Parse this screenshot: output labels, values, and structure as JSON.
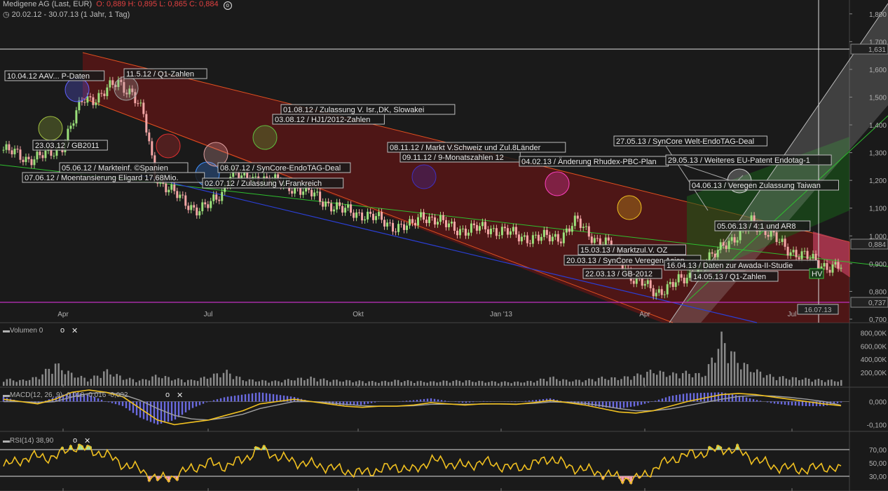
{
  "header": {
    "title": "Medigene AG (Last, EUR)",
    "ohlc": "O: 0,889  H: 0,895  L: 0,865  C: 0,884",
    "range": "20.02.12 - 30.07.13 (1 Jahr, 1 Tag)"
  },
  "colors": {
    "background": "#1a1a1a",
    "up_candle": "#9be07a",
    "down_candle": "#f4a6a6",
    "channel_fill": "#7a1414",
    "green_line": "#2fbf2f",
    "blue_line": "#2b3fd6",
    "magenta_line": "#c030c0",
    "macd_line": "#f0c020",
    "signal_line": "#a0a0a0",
    "histogram": "#6a6ae0",
    "rsi_line": "#f0c020"
  },
  "chart_data": [
    {
      "type": "line",
      "title": "Medigene AG (Last, EUR)",
      "xlabel": "",
      "ylabel": "",
      "x_ticks": [
        "Apr",
        "Jul",
        "Okt",
        "Jan '13",
        "Apr",
        "Jul"
      ],
      "y_ticks": [
        "1,800",
        "1,700",
        "1,600",
        "1,500",
        "1,400",
        "1,300",
        "1,200",
        "1,100",
        "1,000",
        "0,900",
        "0,800",
        "0,700"
      ],
      "ylim": [
        0.7,
        1.85
      ],
      "grid": false,
      "last_price_label": "0,884",
      "hline_labels": [
        "1,631",
        "0,737"
      ],
      "cursor_date_label": "16.07.13",
      "marker_label": "HV",
      "series": [
        {
          "x": [
            "2012-02-20",
            "2012-03-05",
            "2012-03-20",
            "2012-03-28",
            "2012-04-10",
            "2012-04-18",
            "2012-05-02",
            "2012-05-11",
            "2012-05-18",
            "2012-05-25",
            "2012-06-05",
            "2012-06-12",
            "2012-06-20",
            "2012-06-29",
            "2012-07-06",
            "2012-07-12",
            "2012-07-20",
            "2012-08-01",
            "2012-08-10",
            "2012-08-24",
            "2012-09-07",
            "2012-09-20",
            "2012-10-03",
            "2012-10-20",
            "2012-11-02",
            "2012-11-09",
            "2012-11-23",
            "2012-12-07",
            "2012-12-21",
            "2013-01-08",
            "2013-01-22",
            "2013-02-04",
            "2013-02-14",
            "2013-02-28",
            "2013-03-08",
            "2013-03-15",
            "2013-03-22",
            "2013-04-05",
            "2013-04-15",
            "2013-04-29",
            "2013-05-10",
            "2013-05-17",
            "2013-05-27",
            "2013-06-04",
            "2013-06-12",
            "2013-06-20",
            "2013-06-28",
            "2013-07-09",
            "2013-07-16",
            "2013-07-30"
          ],
          "values": [
            1.31,
            1.28,
            1.29,
            1.33,
            1.49,
            1.5,
            1.55,
            1.52,
            1.43,
            1.22,
            1.16,
            1.12,
            1.1,
            1.11,
            1.15,
            1.24,
            1.2,
            1.21,
            1.19,
            1.17,
            1.13,
            1.09,
            1.08,
            1.04,
            1.03,
            1.08,
            1.04,
            1.02,
            1.03,
            1.0,
            0.99,
            1.0,
            1.05,
            0.98,
            0.96,
            0.9,
            0.84,
            0.8,
            0.82,
            0.87,
            0.92,
            0.98,
            0.99,
            1.06,
            1.02,
            0.98,
            0.95,
            0.92,
            0.9,
            0.884
          ]
        }
      ],
      "annotations": [
        "10.04.12 AAV... P-Daten",
        "11.5.12 / Q1-Zahlen",
        "23.03.12 / GB2011",
        "05.06.12 / Markteinf. ©Spanien",
        "07.06.12 / Moentansierung Eligard 17,68Mio.",
        "08.07.12 / SynCore-EndoTAG-Deal",
        "02.07.12 / Zulassung V.Frankreich",
        "01.08.12 / Zulassung V. Isr.,DK, Slowakei",
        "03.08.12 / HJ1/2012-Zahlen",
        "08.11.12 / Markt V.Schweiz und Zul.8Länder",
        "09.11.12 / 9-Monatszahlen 12",
        "04.02.13 / Änderung Rhudex-PBC-Plan",
        "27.05.13 / SynCore Welt-EndoTAG-Deal",
        "29.05.13 / Weiteres EU-Patent Endotag-1",
        "04.06.13 / Veregen Zulassung Taiwan",
        "05.06.13 / 4:1 und AR8",
        "15.03.13 / Marktzul.V. OZ",
        "20.03.13 / SynCore Veregen Asien",
        "16.04.13 / Daten zur Awada-II-Studie",
        "22.03.13 / GB-2012",
        "14.05.13 / Q1-Zahlen"
      ]
    },
    {
      "type": "bar",
      "title": "Volumen",
      "value_label": "0",
      "y_ticks": [
        "800,00K",
        "600,00K",
        "400,00K",
        "200,00K"
      ],
      "ylim": [
        0,
        900000
      ],
      "values": [
        120000,
        90000,
        150000,
        380000,
        200000,
        110000,
        260000,
        140000,
        90000,
        180000,
        120000,
        95000,
        160000,
        250000,
        110000,
        90000,
        80000,
        120000,
        140000,
        100000,
        90000,
        80000,
        70000,
        95000,
        80000,
        70000,
        85000,
        90000,
        75000,
        70000,
        65000,
        80000,
        150000,
        90000,
        100000,
        140000,
        130000,
        180000,
        260000,
        200000,
        230000,
        180000,
        820000,
        420000,
        260000,
        160000,
        140000,
        120000,
        100000,
        90000
      ]
    },
    {
      "type": "line",
      "title": "MACD(12, 26, 9)",
      "values_label": "-0,018  -0,016  -0,002",
      "y_ticks": [
        "0,000",
        "-0,100"
      ],
      "ylim": [
        -0.12,
        0.05
      ],
      "series": [
        {
          "name": "MACD",
          "values": [
            0.01,
            0.0,
            -0.01,
            0.01,
            0.04,
            0.05,
            0.04,
            0.02,
            -0.03,
            -0.08,
            -0.1,
            -0.09,
            -0.08,
            -0.06,
            -0.04,
            -0.01,
            0.0,
            0.01,
            0.0,
            -0.01,
            -0.02,
            -0.025,
            -0.02,
            -0.02,
            -0.015,
            -0.005,
            -0.01,
            -0.015,
            -0.01,
            -0.01,
            -0.012,
            -0.005,
            0.005,
            -0.005,
            -0.015,
            -0.03,
            -0.045,
            -0.05,
            -0.04,
            -0.02,
            0.0,
            0.015,
            0.03,
            0.035,
            0.03,
            0.02,
            0.01,
            0.0,
            -0.01,
            -0.018
          ]
        },
        {
          "name": "Signal",
          "values": [
            0.0,
            0.0,
            -0.005,
            0.0,
            0.02,
            0.035,
            0.04,
            0.03,
            0.005,
            -0.03,
            -0.06,
            -0.075,
            -0.08,
            -0.07,
            -0.055,
            -0.03,
            -0.015,
            0.0,
            0.0,
            -0.005,
            -0.012,
            -0.018,
            -0.02,
            -0.02,
            -0.018,
            -0.012,
            -0.011,
            -0.012,
            -0.011,
            -0.01,
            -0.011,
            -0.008,
            -0.002,
            -0.003,
            -0.008,
            -0.018,
            -0.03,
            -0.04,
            -0.04,
            -0.032,
            -0.018,
            -0.004,
            0.01,
            0.022,
            0.026,
            0.024,
            0.018,
            0.01,
            0.0,
            -0.016
          ]
        }
      ]
    },
    {
      "type": "line",
      "title": "RSI(14)",
      "value_label": "38,90",
      "y_ticks": [
        "70,00",
        "50,00",
        "30,00"
      ],
      "ylim": [
        10,
        90
      ],
      "series": [
        {
          "name": "RSI",
          "values": [
            45,
            55,
            60,
            58,
            75,
            70,
            62,
            48,
            40,
            25,
            30,
            42,
            50,
            45,
            55,
            72,
            60,
            52,
            48,
            44,
            38,
            35,
            40,
            45,
            38,
            55,
            50,
            45,
            52,
            46,
            42,
            48,
            58,
            45,
            40,
            35,
            28,
            25,
            40,
            55,
            62,
            65,
            72,
            68,
            55,
            45,
            42,
            40,
            45,
            38.9
          ]
        }
      ]
    }
  ]
}
